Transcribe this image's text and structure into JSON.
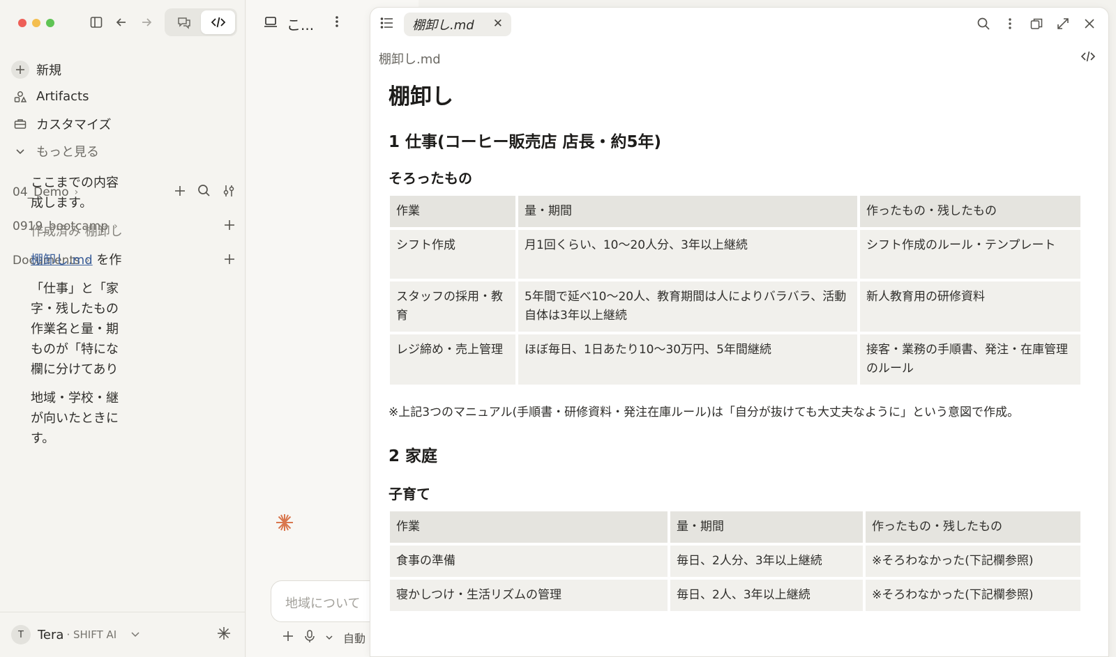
{
  "colors": {
    "accent_link": "#3c5f9a",
    "spark": "#d9774e",
    "traffic_red": "#ee5f57",
    "traffic_yellow": "#f4be4f",
    "traffic_green": "#5fc454"
  },
  "sidebar": {
    "nav": [
      {
        "label": "新規",
        "icon": "plus-icon"
      },
      {
        "label": "Artifacts",
        "icon": "artifacts-icon"
      },
      {
        "label": "カスタマイズ",
        "icon": "briefcase-icon"
      },
      {
        "label": "もっと見る",
        "icon": "chevron-down-icon"
      }
    ],
    "projects": [
      {
        "label": "04_Demo"
      },
      {
        "label": "0919_bootcamp"
      },
      {
        "label": "Documents"
      }
    ],
    "user": {
      "initial": "T",
      "name": "Tera",
      "org": "· SHIFT AI"
    }
  },
  "chat": {
    "title": "こ...",
    "lines": [
      [
        "ここまでの内容",
        "成します。"
      ],
      [
        "作成済み 棚卸し"
      ],
      [
        "棚卸し.md",
        "を作"
      ],
      [
        "「仕事」と「家",
        "字・残したもの",
        "作業名と量・期",
        "ものが「特にな",
        "欄に分けてあり"
      ],
      [
        "地域・学校・継",
        "が向いたときに",
        "す。"
      ]
    ],
    "input_placeholder": "地域について",
    "mode_label": "自動"
  },
  "panel": {
    "tab_title": "棚卸し.md",
    "file_name": "棚卸し.md",
    "doc": {
      "h1": "棚卸し",
      "section1": {
        "h2": "1 仕事(コーヒー販売店 店長・約5年)",
        "h3": "そろったもの",
        "headers": [
          "作業",
          "量・期間",
          "作ったもの・残したもの"
        ],
        "rows": [
          [
            "シフト作成",
            "月1回くらい、10〜20人分、3年以上継続",
            "シフト作成のルール・テンプレート"
          ],
          [
            "スタッフの採用・教育",
            "5年間で延べ10〜20人、教育期間は人によりバラバラ、活動自体は3年以上継続",
            "新人教育用の研修資料"
          ],
          [
            "レジ締め・売上管理",
            "ほぼ毎日、1日あたり10〜30万円、5年間継続",
            "接客・業務の手順書、発注・在庫管理のルール"
          ]
        ],
        "note": "※上記3つのマニュアル(手順書・研修資料・発注在庫ルール)は「自分が抜けても大丈夫なように」という意図で作成。"
      },
      "section2": {
        "h2": "2 家庭",
        "h3": "子育て",
        "headers": [
          "作業",
          "量・期間",
          "作ったもの・残したもの"
        ],
        "rows": [
          [
            "食事の準備",
            "毎日、2人分、3年以上継続",
            "※そろわなかった(下記欄参照)"
          ],
          [
            "寝かしつけ・生活リズムの管理",
            "毎日、2人、3年以上継続",
            "※そろわなかった(下記欄参照)"
          ]
        ]
      }
    }
  }
}
